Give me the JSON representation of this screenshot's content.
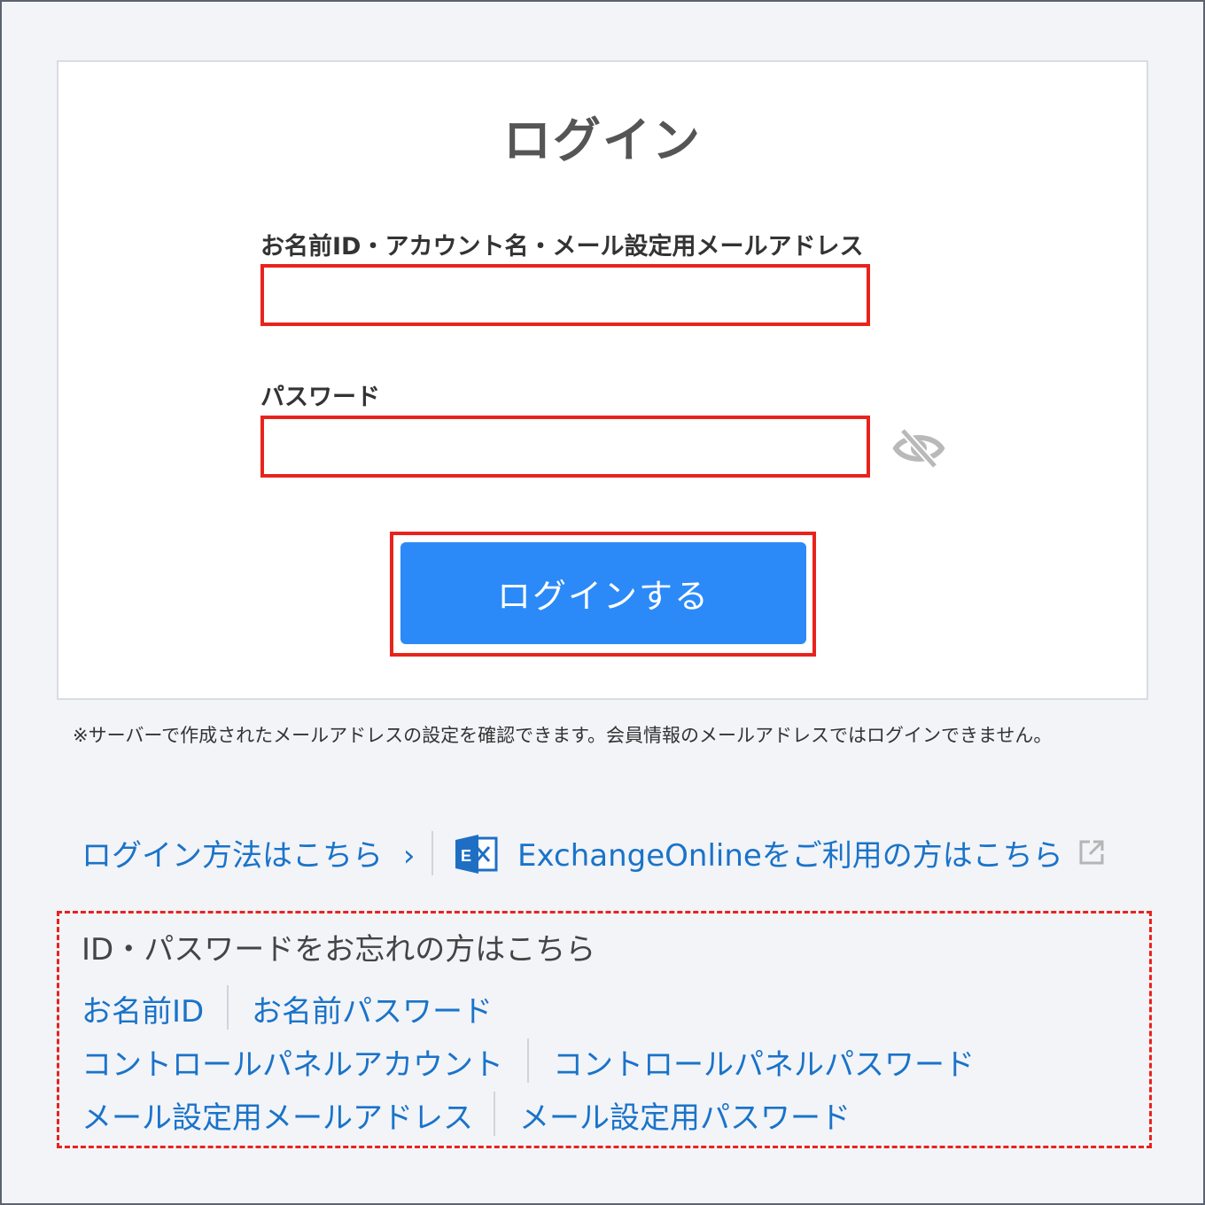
{
  "login": {
    "title": "ログイン",
    "id_label": "お名前ID・アカウント名・メール設定用メールアドレス",
    "password_label": "パスワード",
    "submit_label": "ログインする"
  },
  "note": "※サーバーで作成されたメールアドレスの設定を確認できます。会員情報のメールアドレスではログインできません。",
  "help": {
    "how_to_login": "ログイン方法はこちら",
    "how_to_login_chevron": "›",
    "exchange_online": "ExchangeOnlineをご利用の方はこちら"
  },
  "forgot": {
    "title": "ID・パスワードをお忘れの方はこちら",
    "links": {
      "onamae_id": "お名前ID",
      "onamae_password": "お名前パスワード",
      "cp_account": "コントロールパネルアカウント",
      "cp_password": "コントロールパネルパスワード",
      "mail_address": "メール設定用メールアドレス",
      "mail_password": "メール設定用パスワード"
    }
  },
  "colors": {
    "accent": "#2b8af8",
    "link": "#1a73c9",
    "highlight": "#e8231d",
    "background": "#f2f4f8"
  },
  "icons": [
    "eye-slash-icon",
    "chevron-right-icon",
    "exchange-logo-icon",
    "external-link-icon"
  ]
}
